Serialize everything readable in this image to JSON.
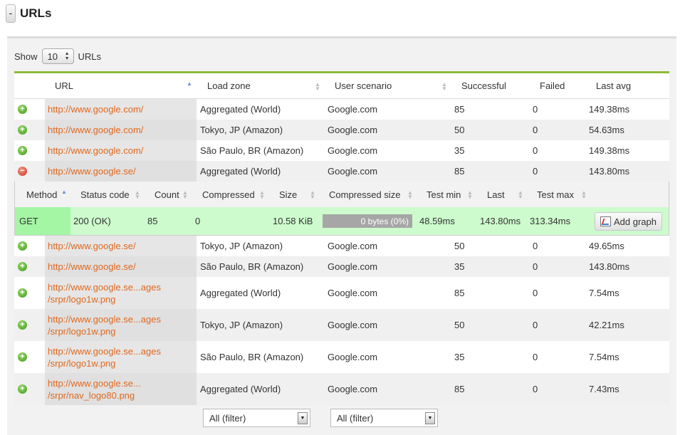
{
  "header": {
    "collapse_label": "-",
    "title": "URLs"
  },
  "show": {
    "prefix": "Show",
    "value": "10",
    "suffix": "URLs"
  },
  "columns": {
    "url": "URL",
    "zone": "Load zone",
    "scenario": "User scenario",
    "successful": "Successful",
    "failed": "Failed",
    "last_avg": "Last avg"
  },
  "rows": [
    {
      "expanded": false,
      "url": "http://www.google.com/",
      "zone": "Aggregated (World)",
      "scenario": "Google.com",
      "successful": "85",
      "failed": "0",
      "last_avg": "149.38ms"
    },
    {
      "expanded": false,
      "url": "http://www.google.com/",
      "zone": "Tokyo, JP (Amazon)",
      "scenario": "Google.com",
      "successful": "50",
      "failed": "0",
      "last_avg": "54.63ms"
    },
    {
      "expanded": false,
      "url": "http://www.google.com/",
      "zone": "São Paulo, BR (Amazon)",
      "scenario": "Google.com",
      "successful": "35",
      "failed": "0",
      "last_avg": "149.38ms"
    },
    {
      "expanded": true,
      "url": "http://www.google.se/",
      "zone": "Aggregated (World)",
      "scenario": "Google.com",
      "successful": "85",
      "failed": "0",
      "last_avg": "143.80ms"
    },
    {
      "expanded": false,
      "url": "http://www.google.se/",
      "zone": "Tokyo, JP (Amazon)",
      "scenario": "Google.com",
      "successful": "50",
      "failed": "0",
      "last_avg": "49.65ms"
    },
    {
      "expanded": false,
      "url": "http://www.google.se/",
      "zone": "São Paulo, BR (Amazon)",
      "scenario": "Google.com",
      "successful": "35",
      "failed": "0",
      "last_avg": "143.80ms"
    },
    {
      "expanded": false,
      "url": "http://www.google.se...ages /srpr/logo1w.png",
      "zone": "Aggregated (World)",
      "scenario": "Google.com",
      "successful": "85",
      "failed": "0",
      "last_avg": "7.54ms"
    },
    {
      "expanded": false,
      "url": "http://www.google.se...ages /srpr/logo1w.png",
      "zone": "Tokyo, JP (Amazon)",
      "scenario": "Google.com",
      "successful": "50",
      "failed": "0",
      "last_avg": "42.21ms"
    },
    {
      "expanded": false,
      "url": "http://www.google.se...ages /srpr/logo1w.png",
      "zone": "São Paulo, BR (Amazon)",
      "scenario": "Google.com",
      "successful": "35",
      "failed": "0",
      "last_avg": "7.54ms"
    },
    {
      "expanded": false,
      "url": "http://www.google.se... /srpr/nav_logo80.png",
      "zone": "Aggregated (World)",
      "scenario": "Google.com",
      "successful": "85",
      "failed": "0",
      "last_avg": "7.43ms"
    }
  ],
  "detail": {
    "columns": {
      "method": "Method",
      "status": "Status code",
      "count": "Count",
      "compressed": "Compressed",
      "size": "Size",
      "compressed_size": "Compressed size",
      "test_min": "Test min",
      "last": "Last",
      "test_max": "Test max"
    },
    "row": {
      "method": "GET",
      "status": "200 (OK)",
      "count": "85",
      "compressed": "0",
      "size": "10.58 KiB",
      "compressed_size": "0 bytes (0%)",
      "test_min": "48.59ms",
      "last": "143.80ms",
      "test_max": "313.34ms"
    },
    "add_graph_label": "Add graph"
  },
  "filters": {
    "zone": "All (filter)",
    "scenario": "All (filter)"
  },
  "colors": {
    "accent": "#8fbc3a",
    "link": "#e0681f",
    "detail_bg": "#cdfbcd"
  }
}
